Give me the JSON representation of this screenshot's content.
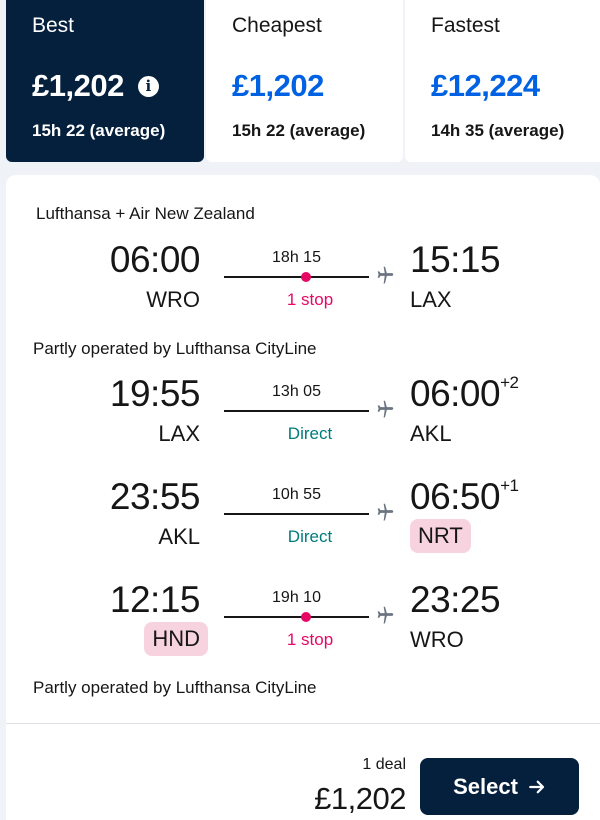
{
  "tabs": [
    {
      "label": "Best",
      "price": "£1,202",
      "duration": "15h 22 (average)"
    },
    {
      "label": "Cheapest",
      "price": "£1,202",
      "duration": "15h 22 (average)"
    },
    {
      "label": "Fastest",
      "price": "£12,224",
      "duration": "14h 35 (average)"
    }
  ],
  "card": {
    "airline": "Lufthansa + Air New Zealand",
    "legs": [
      {
        "dep_time": "06:00",
        "dep_code": "WRO",
        "duration": "18h 15",
        "stops": "1 stop",
        "arr_time": "15:15",
        "arr_code": "LAX",
        "plus_days": ""
      },
      {
        "dep_time": "19:55",
        "dep_code": "LAX",
        "duration": "13h 05",
        "stops": "Direct",
        "arr_time": "06:00",
        "arr_code": "AKL",
        "plus_days": "+2"
      },
      {
        "dep_time": "23:55",
        "dep_code": "AKL",
        "duration": "10h 55",
        "stops": "Direct",
        "arr_time": "06:50",
        "arr_code": "NRT",
        "plus_days": "+1"
      },
      {
        "dep_time": "12:15",
        "dep_code": "HND",
        "duration": "19h 10",
        "stops": "1 stop",
        "arr_time": "23:25",
        "arr_code": "WRO",
        "plus_days": ""
      }
    ],
    "operated_notes": [
      "Partly operated by Lufthansa CityLine",
      "Partly operated by Lufthansa CityLine"
    ],
    "deal_count": "1 deal",
    "price": "£1,202",
    "select_label": "Select"
  },
  "colors": {
    "navy": "#05203c",
    "blue": "#0062e3",
    "stop_pink": "#e70866",
    "direct_teal": "#007b7b",
    "airport_highlight": "#f7d2df"
  },
  "icons": [
    "info-icon",
    "plane-icon",
    "arrow-right-icon"
  ]
}
